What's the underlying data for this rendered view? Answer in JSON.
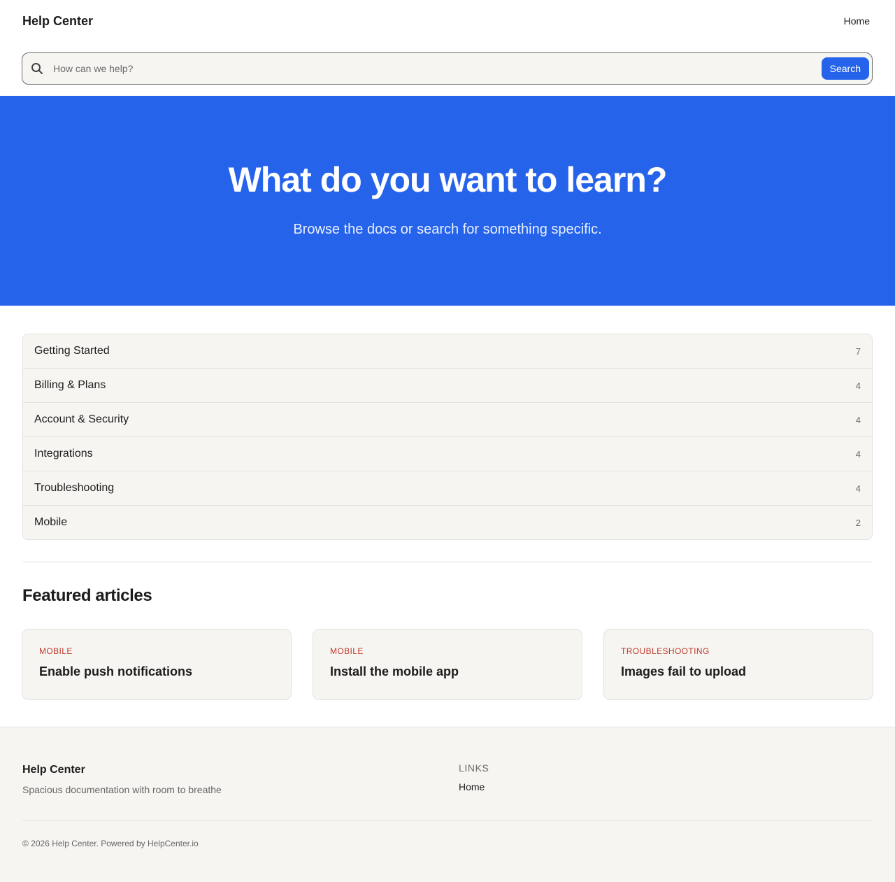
{
  "header": {
    "brand": "Help Center",
    "nav_home": "Home"
  },
  "search": {
    "placeholder": "How can we help?",
    "button_label": "Search",
    "icon": "search-icon"
  },
  "hero": {
    "title": "What do you want to learn?",
    "subtitle": "Browse the docs or search for something specific."
  },
  "categories": [
    {
      "name": "Getting Started",
      "count": "7"
    },
    {
      "name": "Billing & Plans",
      "count": "4"
    },
    {
      "name": "Account & Security",
      "count": "4"
    },
    {
      "name": "Integrations",
      "count": "4"
    },
    {
      "name": "Troubleshooting",
      "count": "4"
    },
    {
      "name": "Mobile",
      "count": "2"
    }
  ],
  "featured": {
    "heading": "Featured articles",
    "articles": [
      {
        "tag": "MOBILE",
        "title": "Enable push notifications"
      },
      {
        "tag": "MOBILE",
        "title": "Install the mobile app"
      },
      {
        "tag": "TROUBLESHOOTING",
        "title": "Images fail to upload"
      }
    ]
  },
  "footer": {
    "brand": "Help Center",
    "tagline": "Spacious documentation with room to breathe",
    "links_heading": "LINKS",
    "links": [
      "Home"
    ],
    "copyright": "© 2026 Help Center. Powered by HelpCenter.io"
  },
  "colors": {
    "accent": "#2563eb",
    "tag": "#c0392b",
    "surface": "#f7f5f2"
  }
}
